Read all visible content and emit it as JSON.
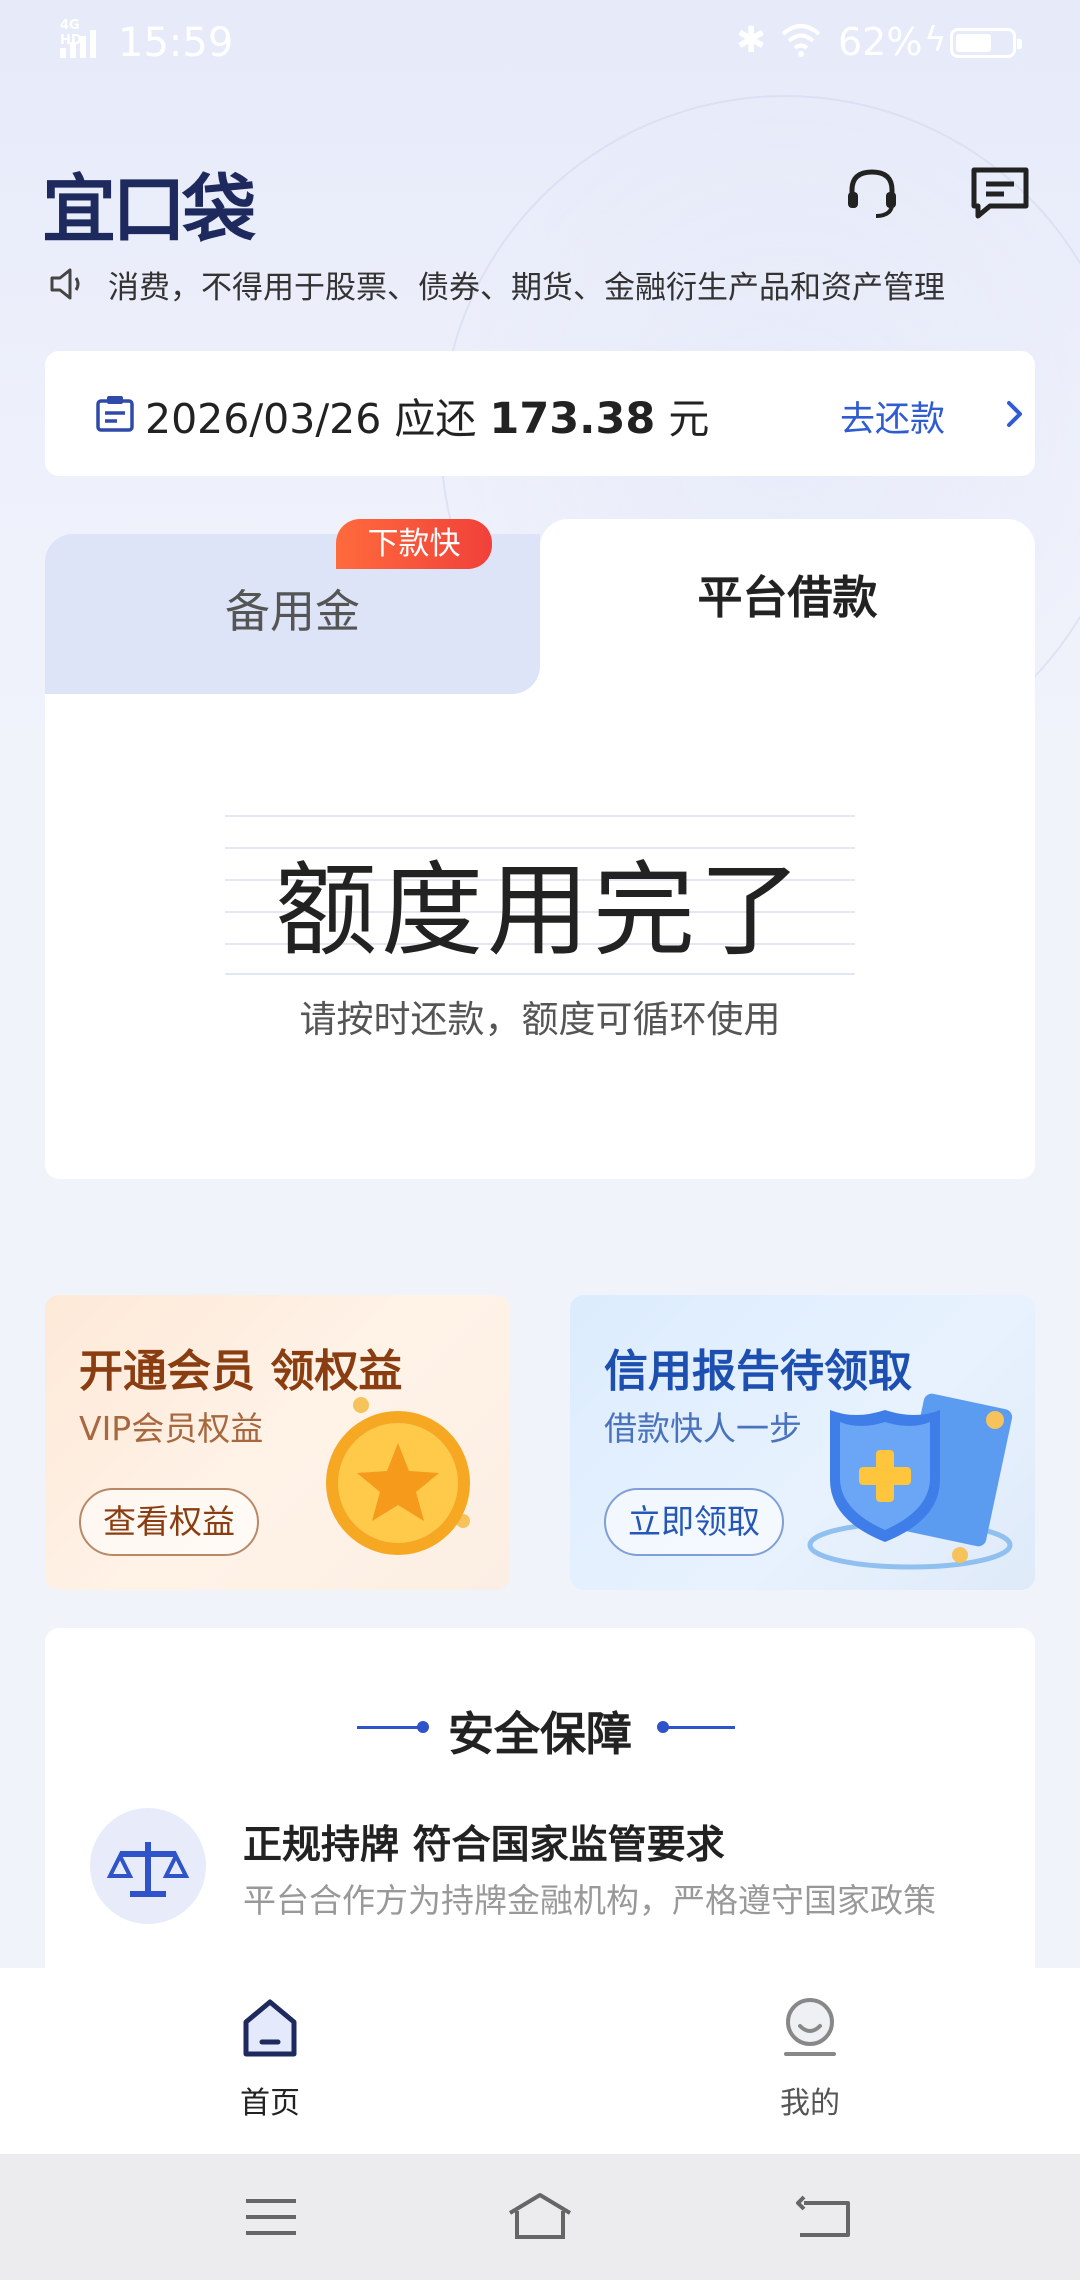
{
  "status_bar": {
    "network": "4G HD",
    "time": "15:59",
    "battery_pct": "62%",
    "battery_level": 0.62
  },
  "header": {
    "logo": "宜口袋",
    "support_icon": "headset-icon",
    "message_icon": "message-icon"
  },
  "notice": {
    "icon": "speaker-icon",
    "text": "消费，不得用于股票、债券、期货、金融衍生产品和资产管理"
  },
  "repayment": {
    "date": "2026/03/26",
    "due_label": "应还",
    "amount": "173.38",
    "unit": "元",
    "action": "去还款"
  },
  "loan": {
    "tabs": [
      {
        "label": "备用金",
        "badge": "下款快",
        "active": false
      },
      {
        "label": "平台借款",
        "active": true
      }
    ],
    "status": "额度用完了",
    "hint": "请按时还款，额度可循环使用"
  },
  "promos": [
    {
      "title": "开通会员 领权益",
      "subtitle": "VIP会员权益",
      "button": "查看权益",
      "icon": "gold-coin-icon"
    },
    {
      "title": "信用报告待领取",
      "subtitle": "借款快人一步",
      "button": "立即领取",
      "icon": "shield-icon"
    }
  ],
  "security": {
    "title": "安全保障",
    "items": [
      {
        "icon": "scale-icon",
        "heading": "正规持牌 符合国家监管要求",
        "desc": "平台合作方为持牌金融机构，严格遵守国家政策"
      }
    ]
  },
  "bottom_nav": [
    {
      "label": "首页",
      "icon": "home-icon",
      "active": true
    },
    {
      "label": "我的",
      "icon": "profile-icon",
      "active": false
    }
  ],
  "system_nav": [
    "menu-icon",
    "home-icon",
    "back-icon"
  ],
  "colors": {
    "accent": "#2f5bd3",
    "logo": "#1e2a5e",
    "badge": "#f0413a",
    "background": "#f1f3fb"
  }
}
